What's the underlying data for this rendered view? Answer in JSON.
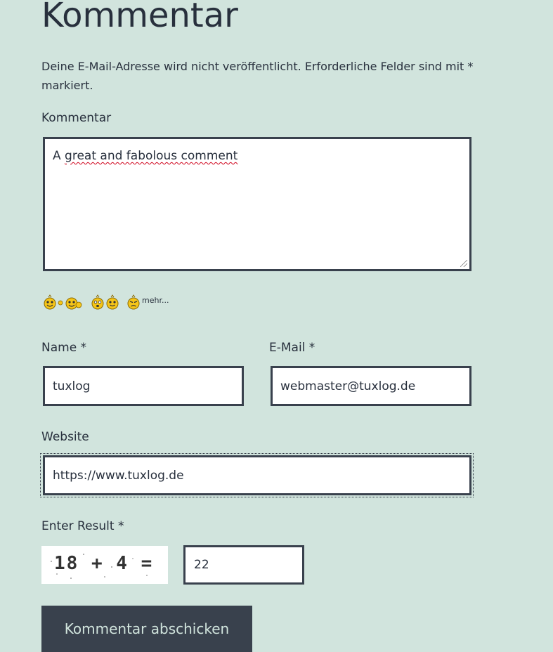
{
  "heading": "Kommentar",
  "notes": {
    "text": "Deine E-Mail-Adresse wird nicht veröffentlicht. Erforderliche Felder sind mit * markiert."
  },
  "comment": {
    "label": "Kommentar",
    "value_prefix": "A ",
    "value_spelled": "great and fabolous comment"
  },
  "smilies": {
    "icons": [
      "waving-smiley-icon",
      "thumbs-smiley-icon",
      "surprised-smiley-icon",
      "smiling-smiley-icon",
      "confused-smiley-icon"
    ],
    "more_label": "mehr..."
  },
  "name": {
    "label": "Name *",
    "value": "tuxlog"
  },
  "email": {
    "label": "E-Mail *",
    "value": "webmaster@tuxlog.de"
  },
  "website": {
    "label": "Website",
    "value": "https://www.tuxlog.de"
  },
  "captcha": {
    "label": "Enter Result *",
    "image_text": "18 + 4 =",
    "answer": "22"
  },
  "submit": {
    "label": "Kommentar abschicken"
  },
  "colors": {
    "background": "#d1e4dd",
    "text": "#28303d",
    "button": "#39414d",
    "button_text": "#d1e4dd"
  }
}
